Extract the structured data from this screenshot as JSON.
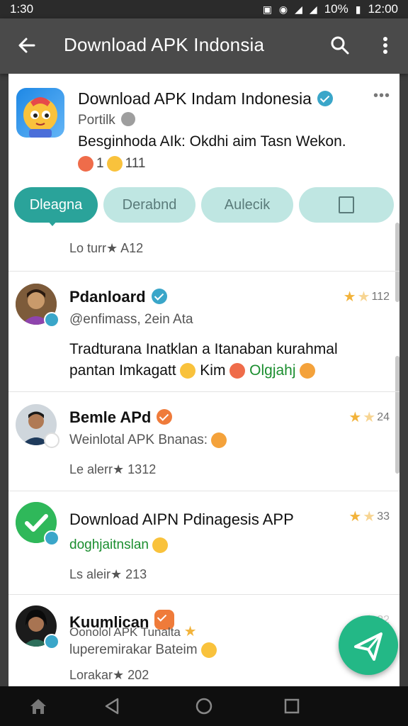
{
  "status_bar": {
    "time": "1:30",
    "battery": "10%",
    "clock": "12:00"
  },
  "app_bar": {
    "title": "Download APK Indonsia"
  },
  "top_app": {
    "name": "Download APK Indam Indonesia",
    "author": "Portilk",
    "description": "Besginhoda AIk: Okdhi aim Tasn Wekon.",
    "reaction_count_1": "1",
    "reaction_count_2": "111",
    "meta": "Lo turr★ A12"
  },
  "tabs": [
    {
      "label": "Dleagna"
    },
    {
      "label": "Derabnd"
    },
    {
      "label": "Aulecik"
    }
  ],
  "items": [
    {
      "title": "Pdanloard",
      "subtitle": "@enfimass, 2ein Ata",
      "body_line1": "Tradturana Inatklan a Itanaban kurahmal",
      "body_line2a": "pantan Imkagatt",
      "body_line2b": "Kim",
      "body_line2c": "Olgjahj",
      "rating": "112"
    },
    {
      "title": "Bemle APd",
      "subtitle": "Weinlotal APK Bnanas:",
      "meta": "Le alerr★ 1312",
      "rating": "24"
    },
    {
      "title": "Download AIPN Pdinagesis APP",
      "subtitle": "doghjaitnslan",
      "meta": "Ls aleir★ 213",
      "rating": "33"
    },
    {
      "title": "Kuumlican",
      "subtitle_overlap": "Oonolol APK Tunalta",
      "subtitle": "luperemirakar Bateim",
      "meta": "Lorakar★ 202",
      "rating": "22"
    }
  ],
  "colors": {
    "accent": "#2aa39a",
    "fab": "#23b886",
    "verified": "#3aa6c9",
    "star": "#f2b33b"
  }
}
